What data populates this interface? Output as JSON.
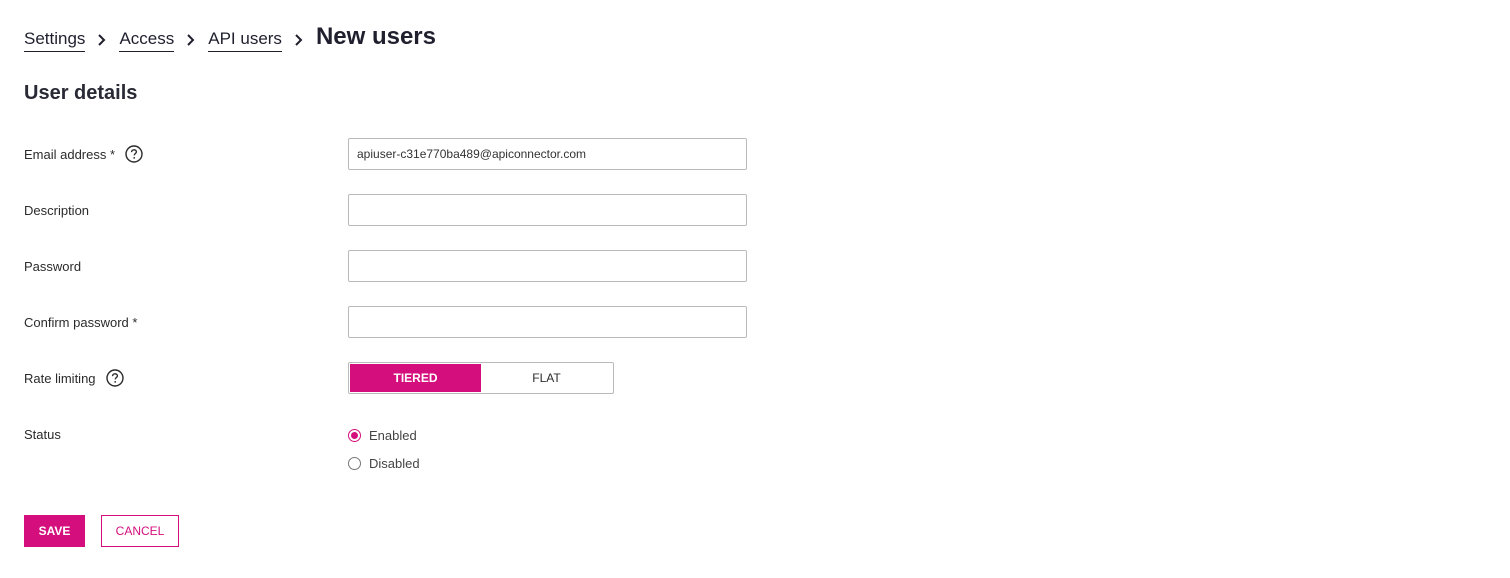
{
  "breadcrumb": {
    "items": [
      "Settings",
      "Access",
      "API users"
    ],
    "current": "New users"
  },
  "section": {
    "title": "User details"
  },
  "form": {
    "email": {
      "label": "Email address *",
      "value": "apiuser-c31e770ba489@apiconnector.com",
      "help_icon": "question-circle-icon"
    },
    "description": {
      "label": "Description",
      "value": ""
    },
    "password": {
      "label": "Password",
      "value": ""
    },
    "confirm_password": {
      "label": "Confirm password *",
      "value": ""
    },
    "rate_limiting": {
      "label": "Rate limiting",
      "help_icon": "question-circle-icon",
      "options": [
        "TIERED",
        "FLAT"
      ],
      "selected": "TIERED"
    },
    "status": {
      "label": "Status",
      "options": [
        "Enabled",
        "Disabled"
      ],
      "selected": "Enabled"
    }
  },
  "actions": {
    "save_label": "SAVE",
    "cancel_label": "CANCEL"
  },
  "colors": {
    "accent": "#d40f7d",
    "text_dark": "#1f1f2e",
    "border": "#b9b9b9"
  }
}
